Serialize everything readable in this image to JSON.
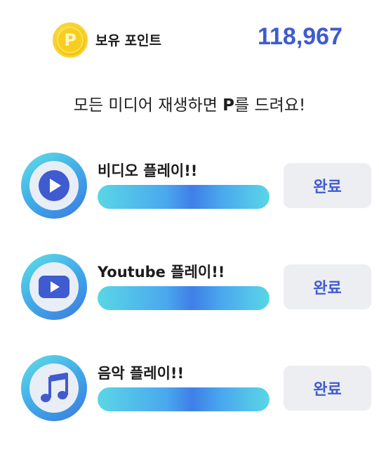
{
  "header": {
    "coin_symbol": "P",
    "points_label": "보유 포인트",
    "points_value": "118,967"
  },
  "headline": {
    "prefix": "모든 미디어 재생하면 ",
    "highlight": "P",
    "suffix": "를 드려요!"
  },
  "tasks": [
    {
      "icon": "play-icon",
      "title": "비디오 플레이!!",
      "button_label": "완료"
    },
    {
      "icon": "youtube-icon",
      "title": "Youtube 플레이!!",
      "button_label": "완료"
    },
    {
      "icon": "music-note-icon",
      "title": "음악 플레이!!",
      "button_label": "완료"
    }
  ],
  "colors": {
    "accent": "#3f5bd0",
    "coin": "#f6c914",
    "bar_gradient_start": "#5ad6e6",
    "bar_gradient_mid": "#3f7ee8",
    "button_bg": "#eceef2"
  }
}
